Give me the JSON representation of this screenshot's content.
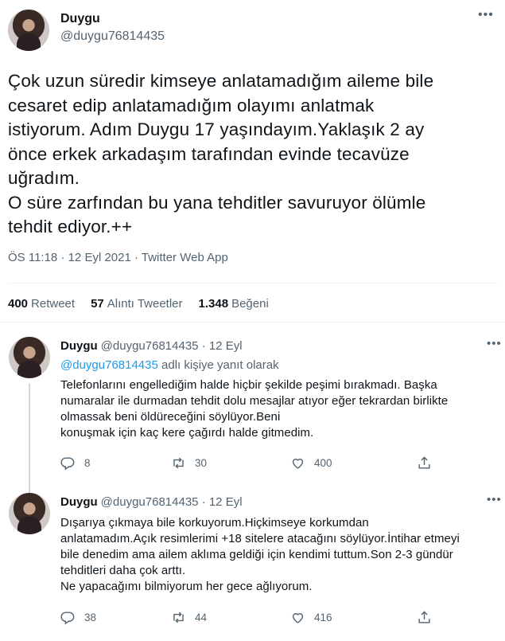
{
  "main_tweet": {
    "name": "Duygu",
    "handle": "@duygu76814435",
    "text": "Çok uzun süredir kimseye anlatamadığım aileme bile\ncesaret edip anlatamadığım olayımı anlatmak\nistiyorum. Adım Duygu 17 yaşındayım.Yaklaşık 2 ay\nönce erkek arkadaşım tarafından evinde tecavüze\nuğradım.\nO süre zarfından bu yana tehditler savuruyor ölümle\ntehdit ediyor.++",
    "meta": "ÖS 11:18 · 12 Eyl 2021 · Twitter Web App",
    "more_icon": "•••"
  },
  "stats": {
    "retweets_count": "400",
    "retweets_label": "Retweet",
    "quotes_count": "57",
    "quotes_label": "Alıntı Tweetler",
    "likes_count": "1.348",
    "likes_label": "Beğeni"
  },
  "replies": [
    {
      "name": "Duygu",
      "handle": "@duygu76814435 · 12 Eyl",
      "replying_mention": "@duygu76814435",
      "replying_suffix": " adlı kişiye yanıt olarak",
      "text": "Telefonlarını engellediğim halde hiçbir şekilde peşimi bırakmadı. Başka\nnumaralar ile durmadan tehdit dolu mesajlar atıyor eğer tekrardan birlikte\nolmassak beni öldüreceğini söylüyor.Beni\nkonuşmak için kaç kere çağırdı halde gitmedim.",
      "reply_count": "8",
      "retweet_count": "30",
      "like_count": "400",
      "more_icon": "•••"
    },
    {
      "name": "Duygu",
      "handle": "@duygu76814435 · 12 Eyl",
      "text": "Dışarıya çıkmaya bile korkuyorum.Hiçkimseye korkumdan\nanlatamadım.Açık resimlerimi +18 sitelere atacağını söylüyor.İntihar etmeyi\nbile denedim ama ailem aklıma geldiği için kendimi tuttum.Son 2-3 gündür\ntehditleri daha çok arttı.\nNe yapacağımı bilmiyorum her gece ağlıyorum.",
      "reply_count": "38",
      "retweet_count": "44",
      "like_count": "416",
      "more_icon": "•••"
    }
  ],
  "colors": {
    "accent": "#1d9bf0",
    "secondary_text": "#536471",
    "divider": "#eff3f4"
  },
  "icons": [
    "reply-icon",
    "retweet-icon",
    "like-icon",
    "share-icon",
    "more-icon"
  ]
}
